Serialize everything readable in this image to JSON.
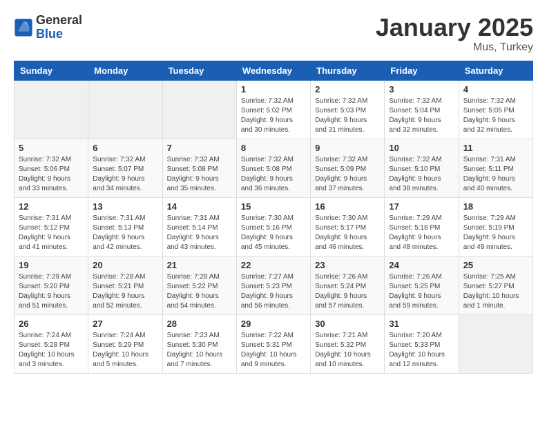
{
  "logo": {
    "general": "General",
    "blue": "Blue"
  },
  "title": "January 2025",
  "subtitle": "Mus, Turkey",
  "weekdays": [
    "Sunday",
    "Monday",
    "Tuesday",
    "Wednesday",
    "Thursday",
    "Friday",
    "Saturday"
  ],
  "weeks": [
    [
      {
        "day": "",
        "info": ""
      },
      {
        "day": "",
        "info": ""
      },
      {
        "day": "",
        "info": ""
      },
      {
        "day": "1",
        "info": "Sunrise: 7:32 AM\nSunset: 5:02 PM\nDaylight: 9 hours\nand 30 minutes."
      },
      {
        "day": "2",
        "info": "Sunrise: 7:32 AM\nSunset: 5:03 PM\nDaylight: 9 hours\nand 31 minutes."
      },
      {
        "day": "3",
        "info": "Sunrise: 7:32 AM\nSunset: 5:04 PM\nDaylight: 9 hours\nand 32 minutes."
      },
      {
        "day": "4",
        "info": "Sunrise: 7:32 AM\nSunset: 5:05 PM\nDaylight: 9 hours\nand 32 minutes."
      }
    ],
    [
      {
        "day": "5",
        "info": "Sunrise: 7:32 AM\nSunset: 5:06 PM\nDaylight: 9 hours\nand 33 minutes."
      },
      {
        "day": "6",
        "info": "Sunrise: 7:32 AM\nSunset: 5:07 PM\nDaylight: 9 hours\nand 34 minutes."
      },
      {
        "day": "7",
        "info": "Sunrise: 7:32 AM\nSunset: 5:08 PM\nDaylight: 9 hours\nand 35 minutes."
      },
      {
        "day": "8",
        "info": "Sunrise: 7:32 AM\nSunset: 5:08 PM\nDaylight: 9 hours\nand 36 minutes."
      },
      {
        "day": "9",
        "info": "Sunrise: 7:32 AM\nSunset: 5:09 PM\nDaylight: 9 hours\nand 37 minutes."
      },
      {
        "day": "10",
        "info": "Sunrise: 7:32 AM\nSunset: 5:10 PM\nDaylight: 9 hours\nand 38 minutes."
      },
      {
        "day": "11",
        "info": "Sunrise: 7:31 AM\nSunset: 5:11 PM\nDaylight: 9 hours\nand 40 minutes."
      }
    ],
    [
      {
        "day": "12",
        "info": "Sunrise: 7:31 AM\nSunset: 5:12 PM\nDaylight: 9 hours\nand 41 minutes."
      },
      {
        "day": "13",
        "info": "Sunrise: 7:31 AM\nSunset: 5:13 PM\nDaylight: 9 hours\nand 42 minutes."
      },
      {
        "day": "14",
        "info": "Sunrise: 7:31 AM\nSunset: 5:14 PM\nDaylight: 9 hours\nand 43 minutes."
      },
      {
        "day": "15",
        "info": "Sunrise: 7:30 AM\nSunset: 5:16 PM\nDaylight: 9 hours\nand 45 minutes."
      },
      {
        "day": "16",
        "info": "Sunrise: 7:30 AM\nSunset: 5:17 PM\nDaylight: 9 hours\nand 46 minutes."
      },
      {
        "day": "17",
        "info": "Sunrise: 7:29 AM\nSunset: 5:18 PM\nDaylight: 9 hours\nand 48 minutes."
      },
      {
        "day": "18",
        "info": "Sunrise: 7:29 AM\nSunset: 5:19 PM\nDaylight: 9 hours\nand 49 minutes."
      }
    ],
    [
      {
        "day": "19",
        "info": "Sunrise: 7:29 AM\nSunset: 5:20 PM\nDaylight: 9 hours\nand 51 minutes."
      },
      {
        "day": "20",
        "info": "Sunrise: 7:28 AM\nSunset: 5:21 PM\nDaylight: 9 hours\nand 52 minutes."
      },
      {
        "day": "21",
        "info": "Sunrise: 7:28 AM\nSunset: 5:22 PM\nDaylight: 9 hours\nand 54 minutes."
      },
      {
        "day": "22",
        "info": "Sunrise: 7:27 AM\nSunset: 5:23 PM\nDaylight: 9 hours\nand 56 minutes."
      },
      {
        "day": "23",
        "info": "Sunrise: 7:26 AM\nSunset: 5:24 PM\nDaylight: 9 hours\nand 57 minutes."
      },
      {
        "day": "24",
        "info": "Sunrise: 7:26 AM\nSunset: 5:25 PM\nDaylight: 9 hours\nand 59 minutes."
      },
      {
        "day": "25",
        "info": "Sunrise: 7:25 AM\nSunset: 5:27 PM\nDaylight: 10 hours\nand 1 minute."
      }
    ],
    [
      {
        "day": "26",
        "info": "Sunrise: 7:24 AM\nSunset: 5:28 PM\nDaylight: 10 hours\nand 3 minutes."
      },
      {
        "day": "27",
        "info": "Sunrise: 7:24 AM\nSunset: 5:29 PM\nDaylight: 10 hours\nand 5 minutes."
      },
      {
        "day": "28",
        "info": "Sunrise: 7:23 AM\nSunset: 5:30 PM\nDaylight: 10 hours\nand 7 minutes."
      },
      {
        "day": "29",
        "info": "Sunrise: 7:22 AM\nSunset: 5:31 PM\nDaylight: 10 hours\nand 9 minutes."
      },
      {
        "day": "30",
        "info": "Sunrise: 7:21 AM\nSunset: 5:32 PM\nDaylight: 10 hours\nand 10 minutes."
      },
      {
        "day": "31",
        "info": "Sunrise: 7:20 AM\nSunset: 5:33 PM\nDaylight: 10 hours\nand 12 minutes."
      },
      {
        "day": "",
        "info": ""
      }
    ]
  ]
}
